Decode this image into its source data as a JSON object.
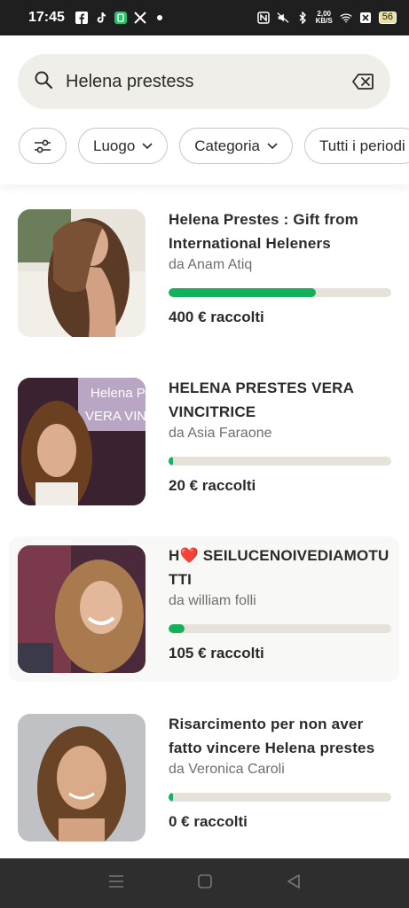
{
  "status_bar": {
    "time": "17:45",
    "net_speed_top": "2,00",
    "net_speed_bottom": "KB/S",
    "battery": "56",
    "icons_left": [
      "facebook-icon",
      "tiktok-icon",
      "app-icon",
      "x-icon",
      "dot-icon"
    ],
    "icons_right": [
      "nfc-icon",
      "mute-icon",
      "bluetooth-icon",
      "wifi-icon",
      "sim-icon",
      "battery-icon"
    ]
  },
  "search": {
    "value": "Helena prestess",
    "placeholder": "Cerca"
  },
  "filters": {
    "location_label": "Luogo",
    "category_label": "Categoria",
    "period_label": "Tutti i periodi"
  },
  "results": [
    {
      "title": "Helena Prestes : Gift from International Heleners",
      "author": "da Anam Atiq",
      "progress": 0.66,
      "raised": "400 € raccolti"
    },
    {
      "title": "HELENA PRESTES VERA VINCITRICE",
      "author": "da Asia Faraone",
      "progress": 0.02,
      "raised": "20 € raccolti",
      "thumb_overlay_line1": "Helena P",
      "thumb_overlay_line2": "VERA VIN"
    },
    {
      "title": "H❤️ SEILUCENOIVEDIAMOTUTTI",
      "author": "da william folli",
      "progress": 0.07,
      "raised": "105 € raccolti"
    },
    {
      "title": "Risarcimento per non aver fatto vincere Helena prestes",
      "author": "da Veronica Caroli",
      "progress": 0.02,
      "raised": "0 € raccolti"
    }
  ],
  "colors": {
    "accent": "#14b05b",
    "track": "#e6e2da",
    "search_bg": "#efeee9",
    "status_bar": "#1f1f1f",
    "nav_bar": "#2e2e2e"
  },
  "nav": {
    "icons": [
      "menu-icon",
      "home-icon",
      "back-icon"
    ]
  }
}
